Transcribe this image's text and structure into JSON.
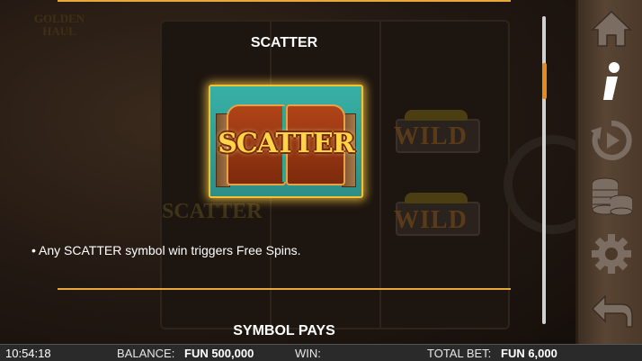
{
  "background_logo": {
    "line1": "GOLDEN",
    "line2": "HAUL"
  },
  "background_symbols": {
    "wild": "WILD",
    "scatter": "SCATTER"
  },
  "info": {
    "scatter_title": "SCATTER",
    "scatter_symbol_text": "SCATTER",
    "scatter_rule": "• Any SCATTER symbol win triggers Free Spins.",
    "next_section_title": "SYMBOL PAYS"
  },
  "sidebar": {
    "items": [
      {
        "name": "home",
        "icon": "home-icon"
      },
      {
        "name": "info",
        "icon": "info-icon",
        "active": true
      },
      {
        "name": "autoplay",
        "icon": "autoplay-icon"
      },
      {
        "name": "bet",
        "icon": "coins-icon"
      },
      {
        "name": "settings",
        "icon": "gear-icon"
      },
      {
        "name": "back",
        "icon": "back-arrow-icon"
      }
    ]
  },
  "status_bar": {
    "time": "10:54:18",
    "balance_label": "BALANCE:",
    "balance_value": "FUN 500,000",
    "win_label": "WIN:",
    "win_value": "",
    "total_bet_label": "TOTAL BET:",
    "total_bet_value": "FUN 6,000"
  },
  "colors": {
    "accent_line": "#e9a83b",
    "scroll_thumb": "#e48a20",
    "card_glow": "#f1c232"
  }
}
